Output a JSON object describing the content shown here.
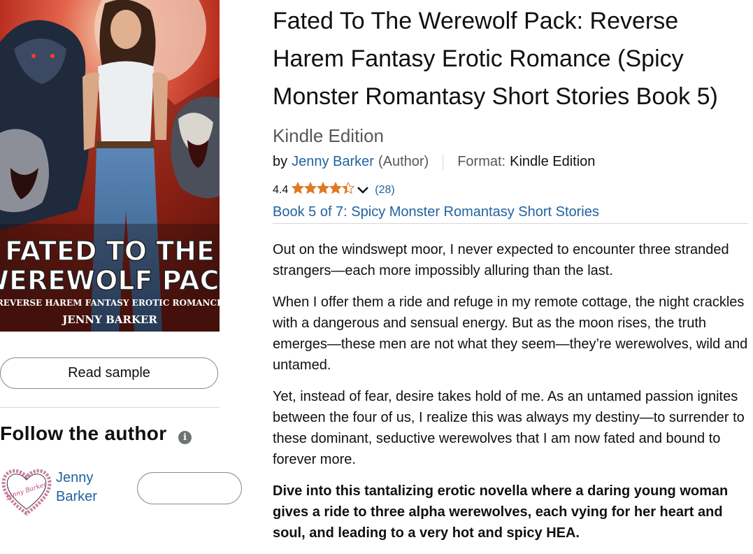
{
  "book": {
    "title": "Fated To The Werewolf Pack: Reverse Harem Fantasy Erotic Romance (Spicy Monster Romantasy Short Stories Book 5)",
    "edition": "Kindle Edition",
    "by_prefix": "by",
    "author": "Jenny Barker",
    "author_role": "(Author)",
    "format_label": "Format:",
    "format_value": "Kindle Edition",
    "rating_value": "4.4",
    "rating_stars": 4.4,
    "rating_count": "(28)",
    "series": "Book 5 of 7: Spicy Monster Romantasy Short Stories"
  },
  "cover": {
    "title_line1": "FATED TO THE",
    "title_line2": "WEREWOLF PACK",
    "subtitle": "REVERSE HAREM FANTASY EROTIC ROMANCE",
    "author": "JENNY BARKER"
  },
  "actions": {
    "read_sample": "Read sample"
  },
  "follow": {
    "title": "Follow the author",
    "author_line1": "Jenny",
    "author_line2": "Barker",
    "follow_button_label": "",
    "avatar_text": "Jenny Barker"
  },
  "description": [
    "Out on the windswept moor, I never expected to encounter three stranded strangers—each more impossibly alluring than the last.",
    "When I offer them a ride and refuge in my remote cottage, the night crackles with a dangerous and sensual energy. But as the moon rises, the truth emerges—these men are not what they seem—they’re werewolves, wild and untamed.",
    "Yet, instead of fear, desire takes hold of me. As an untamed passion ignites between the four of us, I realize this was always my destiny—to surrender to these dominant, seductive werewolves that I am now fated and bound to forever more.",
    "Dive into this tantalizing erotic novella where a daring young woman gives a ride to three alpha werewolves, each vying for her heart and soul, and leading to a very hot and spicy HEA."
  ],
  "colors": {
    "link": "#2162a1",
    "star": "#de7921",
    "muted": "#565959",
    "border": "#888c8c"
  }
}
